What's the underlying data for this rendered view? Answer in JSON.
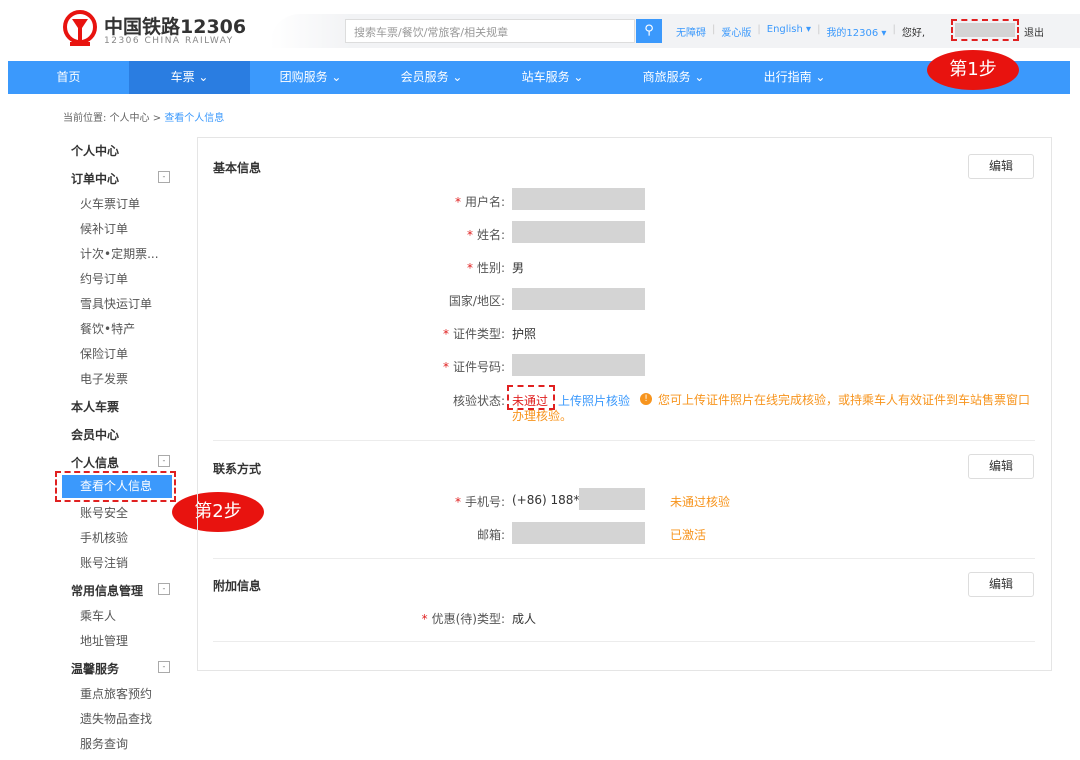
{
  "header": {
    "logo_cn": "中国铁路12306",
    "logo_en": "12306 CHINA RAILWAY",
    "search_placeholder": "搜索车票/餐饮/常旅客/相关规章",
    "links": [
      "无障碍",
      "爱心版",
      "English ▾",
      "我的12306 ▾"
    ],
    "greeting": "您好,",
    "logout": "退出"
  },
  "nav": {
    "items": [
      "首页",
      "车票 ⌄",
      "团购服务 ⌄",
      "会员服务 ⌄",
      "站车服务 ⌄",
      "商旅服务 ⌄",
      "出行指南 ⌄"
    ],
    "active": "车票"
  },
  "annotations": {
    "step1": "第1步",
    "step2": "第2步"
  },
  "breadcrumb": {
    "prefix": "当前位置:",
    "path": "个人中心 >",
    "current": "查看个人信息"
  },
  "sidebar": {
    "home": "个人中心",
    "order_center": "订单中心",
    "orders": [
      "火车票订单",
      "候补订单",
      "计次•定期票...",
      "约号订单",
      "雪具快运订单",
      "餐饮•特产",
      "保险订单",
      "电子发票"
    ],
    "my_tickets": "本人车票",
    "member": "会员中心",
    "personal": "个人信息",
    "personal_items": {
      "active": "查看个人信息",
      "others": [
        "账号安全",
        "手机核验",
        "账号注销"
      ]
    },
    "common": "常用信息管理",
    "common_items": [
      "乘车人",
      "地址管理"
    ],
    "service": "温馨服务",
    "service_items": [
      "重点旅客预约",
      "遗失物品查找",
      "服务查询"
    ]
  },
  "main": {
    "edit_label": "编辑",
    "basic": {
      "title": "基本信息",
      "username": "用户名:",
      "name": "姓名:",
      "gender": "性别:",
      "gender_value": "男",
      "country": "国家/地区:",
      "id_type": "证件类型:",
      "id_type_value": "护照",
      "id_no": "证件号码:",
      "verify": "核验状态:",
      "verify_value": "未通过",
      "upload_link": "上传照片核验",
      "notice": "您可上传证件照片在线完成核验，或持乘车人有效证件到车站售票窗口办理核验。"
    },
    "contact": {
      "title": "联系方式",
      "phone": "手机号:",
      "phone_value": "(+86) 188****",
      "phone_status": "未通过核验",
      "email": "邮箱:",
      "email_status": "已激活"
    },
    "extra": {
      "title": "附加信息",
      "discount": "优惠(待)类型:",
      "discount_value": "成人"
    }
  },
  "colors": {
    "brand_blue": "#3b99fc",
    "active_blue": "#2a7de1",
    "warning": "#f7941d",
    "alert_red": "#e02020"
  }
}
